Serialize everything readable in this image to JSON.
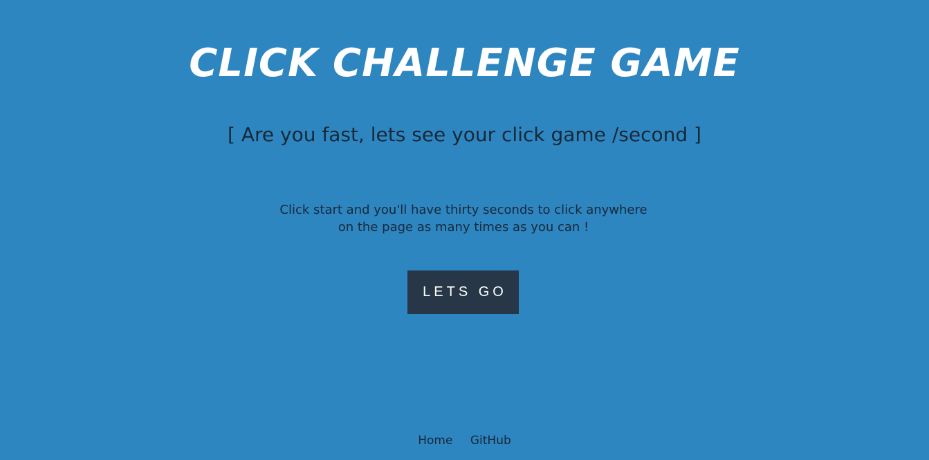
{
  "header": {
    "title": "CLICK CHALLENGE GAME",
    "tagline": "[ Are you fast, lets see your click game /second ]"
  },
  "main": {
    "instructions_line1": "Click start and you'll have thirty seconds to click anywhere",
    "instructions_line2": "on the page as many times as you can !",
    "start_button_label": "LETS GO"
  },
  "footer": {
    "links": [
      {
        "label": "Home"
      },
      {
        "label": "GitHub"
      }
    ]
  },
  "colors": {
    "background": "#2e86c1",
    "button_bg": "#283747",
    "text_dark": "#172838",
    "text_light": "#ffffff"
  }
}
